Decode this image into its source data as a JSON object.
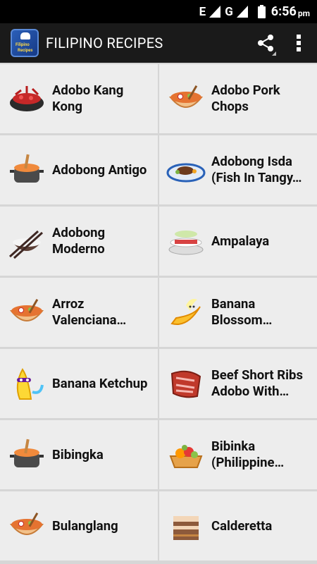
{
  "status_bar": {
    "network_label": "E",
    "network_label_2": "G",
    "time": "6:56",
    "ampm": "pm"
  },
  "app_bar": {
    "title": "FILIPINO RECIPES",
    "logo_text_1": "Filipino",
    "logo_text_2": "Recipes"
  },
  "recipes": [
    {
      "name": "Adobo Kang Kong",
      "icon": "lobster-pot-icon"
    },
    {
      "name": "Adobo Pork Chops",
      "icon": "soup-bowl-icon"
    },
    {
      "name": "Adobong Antigo",
      "icon": "cooking-pot-icon"
    },
    {
      "name": "Adobong Isda (Fish In Tangy…",
      "icon": "steak-plate-icon"
    },
    {
      "name": "Adobong Moderno",
      "icon": "rice-bowl-icon"
    },
    {
      "name": "Ampalaya",
      "icon": "layered-plate-icon"
    },
    {
      "name": "Arroz Valenciana…",
      "icon": "soup-bowl-icon"
    },
    {
      "name": "Banana Blossom…",
      "icon": "banana-icon"
    },
    {
      "name": "Banana Ketchup",
      "icon": "banana-character-icon"
    },
    {
      "name": "Beef Short Ribs Adobo With…",
      "icon": "beef-ribs-icon"
    },
    {
      "name": "Bibingka",
      "icon": "cooking-pot-icon"
    },
    {
      "name": "Bibinka (Philippine…",
      "icon": "fruit-tart-icon"
    },
    {
      "name": "Bulanglang",
      "icon": "soup-bowl-icon"
    },
    {
      "name": "Calderetta",
      "icon": "cake-slice-icon"
    }
  ]
}
